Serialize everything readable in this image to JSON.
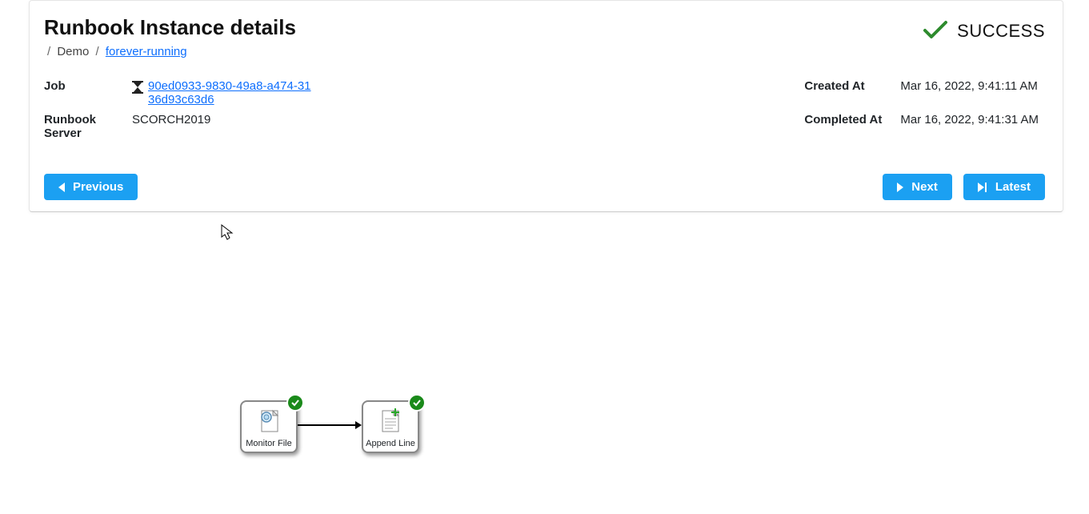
{
  "header": {
    "title": "Runbook Instance details",
    "breadcrumb": {
      "item1": "Demo",
      "item2": "forever-running"
    },
    "status": "SUCCESS"
  },
  "details": {
    "left": {
      "job_label": "Job",
      "job_id": "90ed0933-9830-49a8-a474-3136d93c63d6",
      "server_label": "Runbook Server",
      "server_value": "SCORCH2019"
    },
    "right": {
      "created_label": "Created At",
      "created_value": "Mar 16, 2022, 9:41:11 AM",
      "completed_label": "Completed At",
      "completed_value": "Mar 16, 2022, 9:41:31 AM"
    }
  },
  "buttons": {
    "previous": "Previous",
    "next": "Next",
    "latest": "Latest"
  },
  "diagram": {
    "activities": [
      {
        "name": "Monitor File"
      },
      {
        "name": "Append Line"
      }
    ]
  }
}
